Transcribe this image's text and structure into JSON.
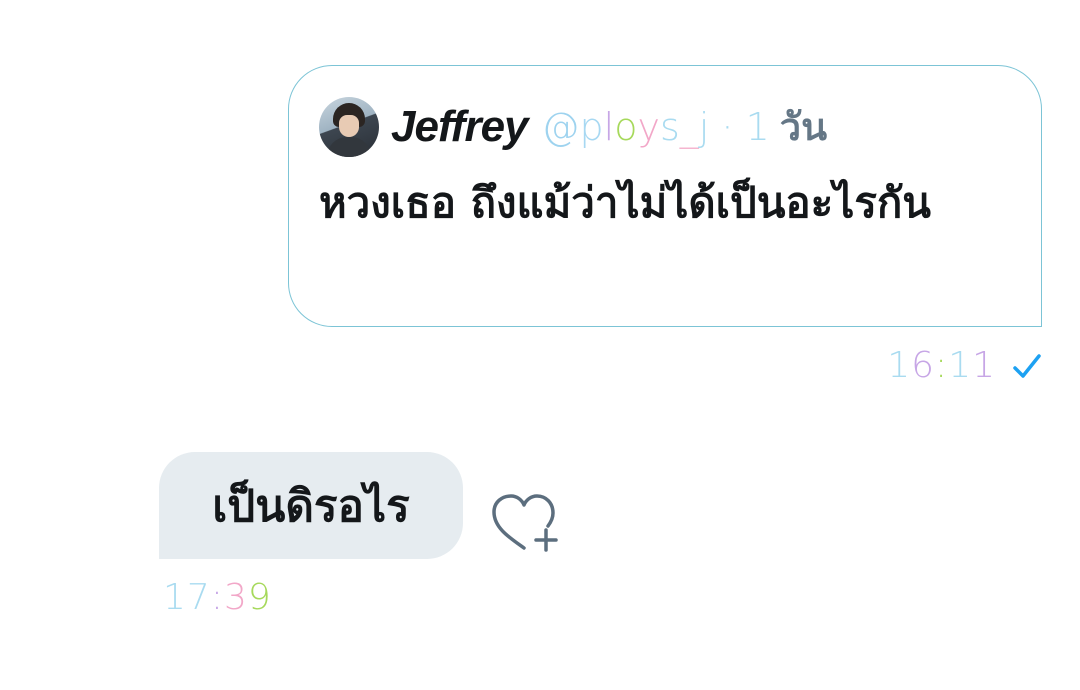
{
  "quoted_tweet": {
    "display_name": "Jeffrey",
    "handle_chars": [
      {
        "ch": "@",
        "color": "#9ed3ef"
      },
      {
        "ch": "p",
        "color": "#a7d8f2"
      },
      {
        "ch": "l",
        "color": "#c7a6e6"
      },
      {
        "ch": "o",
        "color": "#a6d95b"
      },
      {
        "ch": "y",
        "color": "#f2a7c8"
      },
      {
        "ch": "s",
        "color": "#a9dbf0"
      },
      {
        "ch": "_",
        "color": "#f5b5cf"
      },
      {
        "ch": "j",
        "color": "#a9dbf0"
      }
    ],
    "separator": " · ",
    "age_number": "1",
    "age_unit": "วัน",
    "text": "หวงเธอ ถึงแม้ว่าไม่ได้เป็นอะไรกัน"
  },
  "sent_meta": {
    "time_chars": [
      {
        "ch": "1",
        "color": "#a9dbf0"
      },
      {
        "ch": "6",
        "color": "#c7a6e6"
      },
      {
        "ch": ":",
        "color": "#a6d95b"
      },
      {
        "ch": "1",
        "color": "#a9dbf0"
      },
      {
        "ch": "1",
        "color": "#c7a6e6"
      }
    ],
    "status_icon": "check-icon"
  },
  "received_message": {
    "text": "เป็นดิรอไร",
    "reaction_icon": "heart-plus-icon",
    "time_chars": [
      {
        "ch": "1",
        "color": "#a9dbf0"
      },
      {
        "ch": "7",
        "color": "#a9dbf0"
      },
      {
        "ch": ":",
        "color": "#c7a6e6"
      },
      {
        "ch": "3",
        "color": "#f2a7c8"
      },
      {
        "ch": "9",
        "color": "#a6d95b"
      }
    ]
  },
  "colors": {
    "accent": "#1da1f2",
    "bubble_bg": "#e6ecf0",
    "card_border": "#7cc4d6",
    "icon_gray": "#657786"
  }
}
